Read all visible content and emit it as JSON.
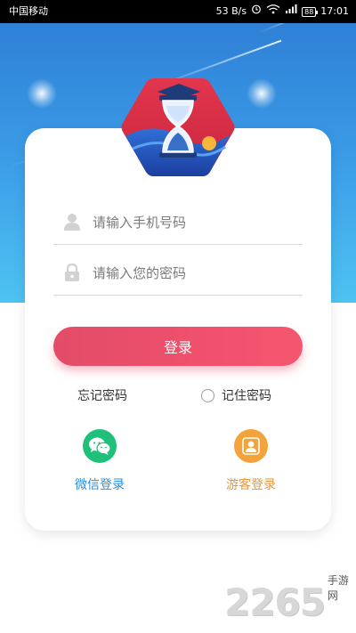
{
  "status_bar": {
    "carrier": "中国移动",
    "speed": "53 B/s",
    "battery": "88",
    "time": "17:01"
  },
  "logo": {
    "icon": "hourglass-graduation-logo"
  },
  "form": {
    "phone_placeholder": "请输入手机号码",
    "password_placeholder": "请输入您的密码",
    "login_label": "登录",
    "forgot_label": "忘记密码",
    "remember_label": "记住密码",
    "remember_checked": false
  },
  "social": {
    "wechat_label": "微信登录",
    "guest_label": "游客登录",
    "wechat_color": "#1fc07a",
    "guest_color": "#f4a23a"
  },
  "colors": {
    "hero_top": "#2f80d6",
    "hero_bottom": "#4ec3f2",
    "login_button": "#ee4f6a"
  },
  "watermark": {
    "number": "2265",
    "site": "手游网"
  }
}
